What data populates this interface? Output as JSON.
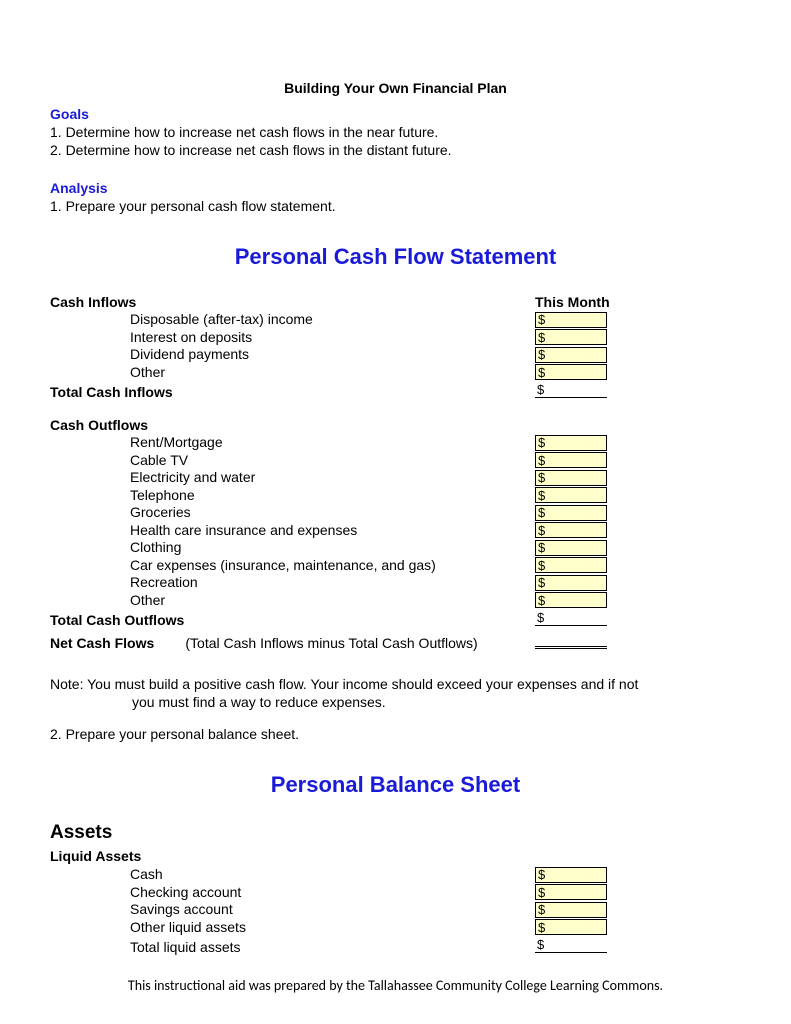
{
  "doc_title": "Building Your Own Financial Plan",
  "goals": {
    "label": "Goals",
    "items": [
      "1. Determine how to increase net cash flows in the near future.",
      "2. Determine how to increase net cash flows in the distant future."
    ]
  },
  "analysis": {
    "label": "Analysis",
    "item1": "1. Prepare your personal cash flow statement."
  },
  "cashflow": {
    "heading": "Personal Cash Flow Statement",
    "inflows_label": "Cash Inflows",
    "this_month_label": "This Month",
    "inflow_items": [
      "Disposable (after-tax) income",
      "Interest on deposits",
      "Dividend payments",
      "Other"
    ],
    "total_inflows_label": "Total Cash Inflows",
    "outflows_label": "Cash Outflows",
    "outflow_items": [
      "Rent/Mortgage",
      "Cable TV",
      "Electricity and water",
      "Telephone",
      "Groceries",
      "Health care insurance and expenses",
      "Clothing",
      "Car expenses (insurance, maintenance, and gas)",
      "Recreation",
      "Other"
    ],
    "total_outflows_label": "Total Cash Outflows",
    "net_label": "Net Cash Flows",
    "net_paren": "(Total Cash Inflows minus Total Cash Outflows)"
  },
  "note_line1": "Note: You must build a positive cash flow.  Your income should exceed your expenses and if not",
  "note_line2": "you must find a way to reduce expenses.",
  "step2": "2. Prepare your personal balance sheet.",
  "balance": {
    "heading": "Personal Balance Sheet",
    "assets_label": "Assets",
    "liquid_label": "Liquid Assets",
    "liquid_items": [
      "Cash",
      "Checking account",
      "Savings account",
      "Other liquid assets"
    ],
    "total_liquid_label": "Total liquid assets"
  },
  "dollar": "$",
  "footer": "This instructional aid was prepared by the Tallahassee Community College Learning Commons."
}
